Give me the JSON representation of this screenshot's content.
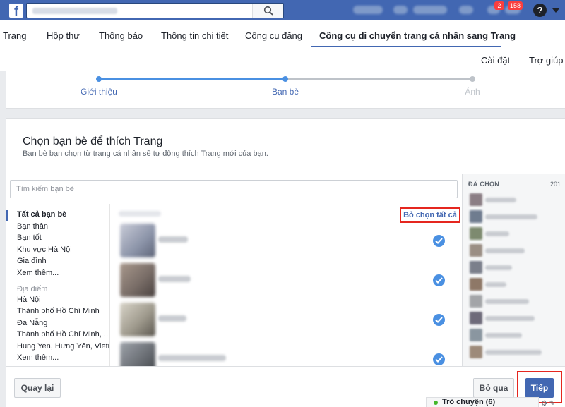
{
  "topbar": {
    "logo": "f",
    "help": "?",
    "badges": [
      "2",
      "158"
    ]
  },
  "tabs": [
    {
      "label": "Trang"
    },
    {
      "label": "Hộp thư"
    },
    {
      "label": "Thông báo"
    },
    {
      "label": "Thông tin chi tiết"
    },
    {
      "label": "Công cụ đăng"
    },
    {
      "label": "Công cụ di chuyển trang cá nhân sang Trang"
    }
  ],
  "subnav": {
    "settings": "Cài đặt",
    "help": "Trợ giúp"
  },
  "stepper": {
    "steps": [
      {
        "label": "Giới thiệu",
        "state": "done"
      },
      {
        "label": "Bạn bè",
        "state": "current"
      },
      {
        "label": "Ảnh",
        "state": "pending"
      }
    ],
    "colors": {
      "active": "#4a90e2",
      "inactive": "#bec3c9"
    }
  },
  "card": {
    "title": "Chọn bạn bè để thích Trang",
    "subtitle": "Bạn bè bạn chọn từ trang cá nhân sẽ tự động thích Trang mới của bạn.",
    "search_placeholder": "Tìm kiếm bạn bè"
  },
  "categories": {
    "items": [
      {
        "label": "Tất cả bạn bè",
        "active": true
      },
      {
        "label": "Bạn thân"
      },
      {
        "label": "Bạn tốt"
      },
      {
        "label": "Khu vực Hà Nội"
      },
      {
        "label": "Gia đình"
      },
      {
        "label": "Xem thêm..."
      }
    ],
    "places_head": "Địa điểm",
    "places": [
      {
        "label": "Hà Nội"
      },
      {
        "label": "Thành phố Hồ Chí Minh"
      },
      {
        "label": "Đà Nẵng"
      },
      {
        "label": "Thành phố Hồ Chí Minh, ..."
      },
      {
        "label": "Hung Yen, Hưng Yên, Vietn..."
      },
      {
        "label": "Xem thêm..."
      }
    ]
  },
  "friends": {
    "unselect_all": "Bỏ chọn tất cả",
    "rows": [
      {
        "selected": true,
        "photo_color": "#8b93a8"
      },
      {
        "selected": true,
        "photo_color": "#7a6e68"
      },
      {
        "selected": true,
        "photo_color": "#a09b8e"
      },
      {
        "selected": true,
        "photo_color": "#6b6f75"
      }
    ]
  },
  "selected_panel": {
    "heading": "ĐÃ CHỌN",
    "count": "201",
    "avatar_colors": [
      "#8a7d84",
      "#6f7c8f",
      "#7d8a6f",
      "#9a8e84",
      "#7b7f8b",
      "#8e7867",
      "#a3a5a8",
      "#6e6a7a",
      "#8a96a0",
      "#9d8a7a",
      "#7a8e86",
      "#867c72"
    ]
  },
  "footer": {
    "back": "Quay lại",
    "skip": "Bỏ qua",
    "next": "Tiếp"
  },
  "chat": {
    "label": "Trò chuyện (6)"
  }
}
